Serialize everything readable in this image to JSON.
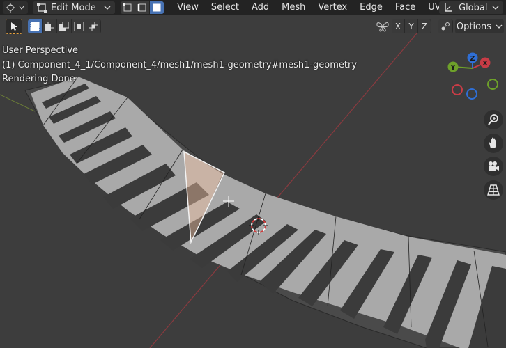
{
  "header": {
    "mode": "Edit Mode",
    "menu": [
      "View",
      "Select",
      "Add",
      "Mesh",
      "Vertex",
      "Edge",
      "Face",
      "UV"
    ],
    "transform_orientation": "Global"
  },
  "toolbar": {
    "mirror_axes": [
      "X",
      "Y",
      "Z"
    ],
    "options_label": "Options"
  },
  "viewport": {
    "perspective": "User Perspective",
    "object_path": "(1) Component_4_1/Component_4/mesh1/mesh1-geometry#mesh1-geometry",
    "status": "Rendering Done"
  },
  "gizmo": {
    "axes": [
      "X",
      "Y",
      "Z"
    ],
    "colors": {
      "x": "#c83c46",
      "y": "#6ea12a",
      "z": "#2f6fd6"
    }
  }
}
